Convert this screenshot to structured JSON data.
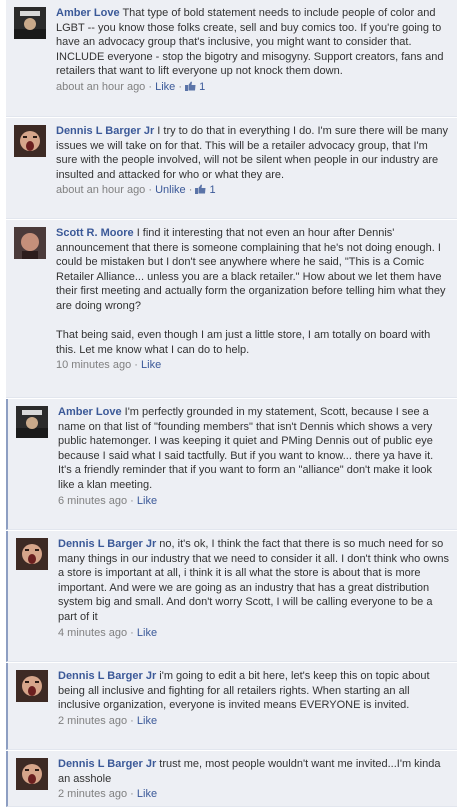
{
  "comments": [
    {
      "author": "Amber Love",
      "text": "That type of bold statement needs to include people of color and LGBT -- you know those folks create, sell and buy comics too. If you're going to have an advocacy group that's inclusive, you might want to consider that. INCLUDE everyone - stop the bigotry and misogyny. Support creators, fans and retailers that want to lift everyone up not knock them down.",
      "time": "about an hour ago",
      "like_label": "Like",
      "like_count": "1",
      "avatar_icon": "amber-avatar-icon"
    },
    {
      "author": "Dennis L Barger Jr",
      "text": "I try to do that in everything I do. I'm sure there will be many issues we will take on for that. This will be a retailer advocacy group, that I'm sure with the people involved, will not be silent when people in our industry are insulted and attacked for who or what they are.",
      "time": "about an hour ago",
      "like_label": "Unlike",
      "like_count": "1",
      "avatar_icon": "dennis-avatar-icon"
    },
    {
      "author": "Scott R. Moore",
      "text": "I find it interesting that not even an hour after Dennis' announcement that there is someone complaining that he's not doing enough. I could be mistaken but I don't see anywhere where he said, \"This is a Comic Retailer Alliance... unless you are a black retailer.\" How about we let them have their first meeting and actually form the organization before telling him what they are doing wrong?\n\nThat being said, even though I am just a little store, I am totally on board with this. Let me know what I can do to help.",
      "time": "10 minutes ago",
      "like_label": "Like",
      "avatar_icon": "scott-avatar-icon"
    },
    {
      "author": "Amber Love",
      "text": "I'm perfectly grounded in my statement, Scott, because I see a name on that list of \"founding members\" that isn't Dennis which shows a very public hatemonger. I was keeping it quiet and PMing Dennis out of public eye because I said what I said tactfully. But if you want to know... there ya have it. It's a friendly reminder that if you want to form an \"alliance\" don't make it look like a klan meeting.",
      "time": "6 minutes ago",
      "like_label": "Like",
      "avatar_icon": "amber-avatar-icon"
    },
    {
      "author": "Dennis L Barger Jr",
      "text": "no, it's ok, I think the fact that there is so much need for so many things in our industry that we need to consider it all. I don't think who owns a store is important at all, i think it is all what the store is about that is more important. And were we are going as an industry that has a great distribution system big and small. And don't worry Scott, I will be calling everyone to be a part of it",
      "time": "4 minutes ago",
      "like_label": "Like",
      "avatar_icon": "dennis-avatar-icon"
    },
    {
      "author": "Dennis L Barger Jr",
      "text": "i'm going to edit a bit here, let's keep this on topic about being all inclusive and fighting for all retailers rights. When starting an all inclusive organization, everyone is invited means EVERYONE is invited.",
      "time": "2 minutes ago",
      "like_label": "Like",
      "avatar_icon": "dennis-avatar-icon"
    },
    {
      "author": "Dennis L Barger Jr",
      "text": "trust me, most people wouldn't want me invited...I'm kinda an asshole",
      "time": "2 minutes ago",
      "like_label": "Like",
      "avatar_icon": "dennis-avatar-icon"
    }
  ],
  "separator": "·",
  "colors": {
    "link": "#3b5998",
    "background": "#edeff4",
    "meta": "#808080"
  }
}
